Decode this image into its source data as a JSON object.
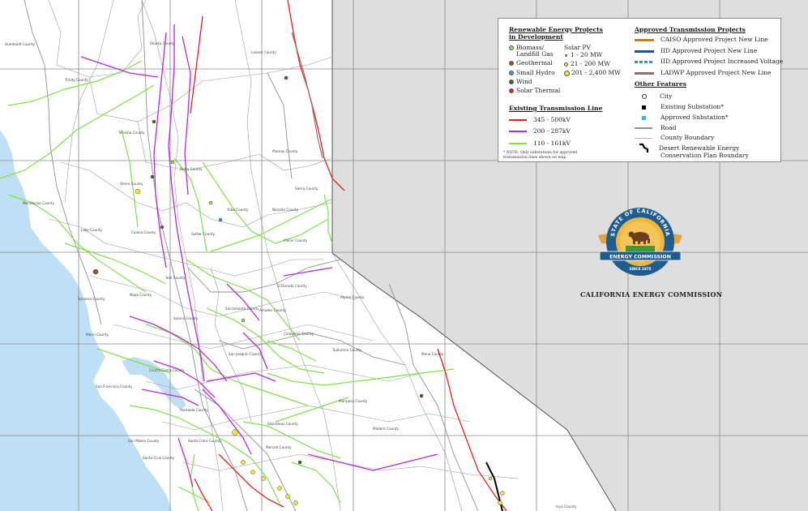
{
  "legend": {
    "rep_title_1": "Renewable Energy Projects",
    "rep_title_2": "in Development",
    "rep_items": [
      {
        "label": "Biomass/",
        "label2": "Landfill Gas",
        "color": "#8fe05a"
      },
      {
        "label": "Geothermal",
        "color": "#8b5a2b"
      },
      {
        "label": "Small Hydro",
        "color": "#3a9ad9"
      },
      {
        "label": "Wind",
        "color": "#2f6b2a"
      },
      {
        "label": "Solar Thermal",
        "color": "#e0231b"
      }
    ],
    "solar_pv_title": "Solar PV",
    "solar_pv_items": [
      {
        "label": "1 - 20 MW",
        "color": "#f5e63a"
      },
      {
        "label": "21 - 200 MW",
        "color": "#f5e63a"
      },
      {
        "label": "201 - 2,400 MW",
        "color": "#f5e63a"
      }
    ],
    "etl_title": "Existing Transmission Line",
    "etl_items": [
      {
        "label": "345 - 500kV",
        "color": "#e0231b"
      },
      {
        "label": "200 - 287kV",
        "color": "#b52ad8"
      },
      {
        "label": "110 - 161kV",
        "color": "#7ee04a"
      }
    ],
    "note_1": "* NOTE: Only substations for approved",
    "note_2": "transmission lines shown on map",
    "atp_title": "Approved Transmission Projects",
    "atp_items": [
      {
        "label": "CAISO Approved Project New Line",
        "color": "#b8842a"
      },
      {
        "label": "IID Approved Project New Line",
        "color": "#1f4fa0"
      },
      {
        "label": "IID Approved Project Increased Voltage",
        "color": "#3a8ad9"
      },
      {
        "label": "LADWP Approved Project New Line",
        "color": "#9a6b70"
      }
    ],
    "of_title": "Other Features",
    "of_items": [
      {
        "label": "City"
      },
      {
        "label": "Existing Substation*"
      },
      {
        "label": "Approved Substation*"
      },
      {
        "label": "Road"
      },
      {
        "label": "County Boundary"
      },
      {
        "label": "Desert Renewable Energy",
        "label2": "Conservation Plan Boundary"
      }
    ]
  },
  "seal": {
    "top_text": "STATE OF CALIFORNIA",
    "band_text": "ENERGY COMMISSION",
    "bottom_text": "SINCE 1975"
  },
  "org_label": "CALIFORNIA ENERGY COMMISSION",
  "counties": [
    "Humboldt County",
    "Trinity County",
    "Shasta County",
    "Lassen County",
    "Tehama County",
    "Plumas County",
    "Glenn County",
    "Butte County",
    "Mendocino County",
    "Sierra County",
    "Nevada County",
    "Yuba County",
    "Sutter County",
    "Colusa County",
    "Lake County",
    "Placer County",
    "Yolo County",
    "El Dorado County",
    "Sonoma County",
    "Napa County",
    "Sacramento County",
    "Alpine County",
    "Amador County",
    "Solano County",
    "Marin County",
    "Calaveras County",
    "San Joaquin County",
    "Tuolumne County",
    "Mono County",
    "San Francisco County",
    "Contra Costa County",
    "Alameda County",
    "Stanislaus County",
    "Mariposa County",
    "San Mateo County",
    "Santa Clara County",
    "Merced County",
    "Madera County",
    "Santa Cruz County",
    "Inyo County"
  ],
  "colors": {
    "ocean": "#bfe0f4",
    "outside_state": "#dedede",
    "land": "#ffffff",
    "grid": "#8a8a8a"
  }
}
